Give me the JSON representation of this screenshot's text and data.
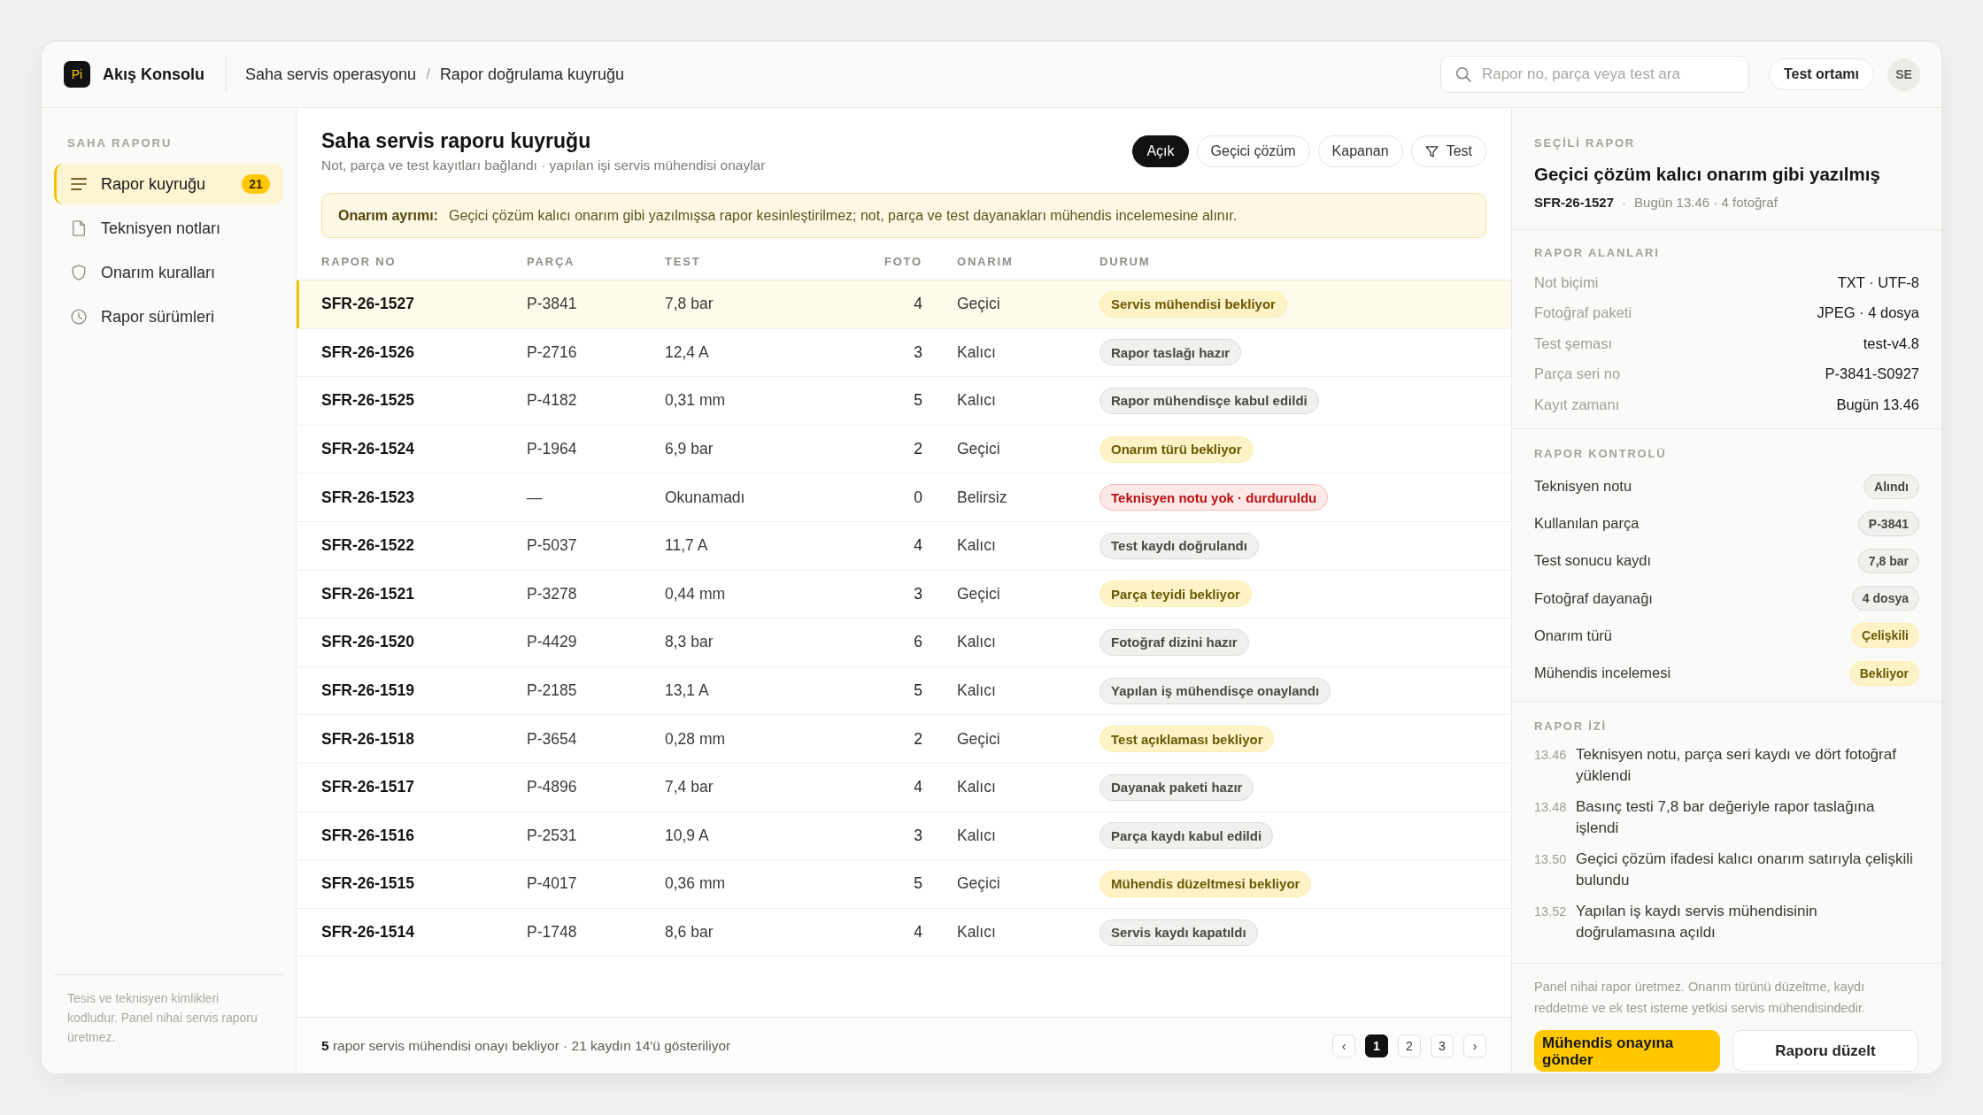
{
  "app": {
    "logo": "Pi",
    "name": "Akış Konsolu"
  },
  "breadcrumb": {
    "items": [
      "Saha servis operasyonu",
      "Rapor doğrulama kuyruğu"
    ],
    "separator": "/"
  },
  "search": {
    "placeholder": "Rapor no, parça veya test ara"
  },
  "environment": "Test ortamı",
  "avatar": "SE",
  "sidebar": {
    "section": "SAHA RAPORU",
    "items": [
      {
        "label": "Rapor kuyruğu",
        "badge": "21",
        "selected": true
      },
      {
        "label": "Teknisyen notları",
        "selected": false
      },
      {
        "label": "Onarım kuralları",
        "selected": false
      },
      {
        "label": "Rapor sürümleri",
        "selected": false
      }
    ],
    "footer": "Tesis ve teknisyen kimlikleri kodludur. Panel nihai servis raporu üretmez."
  },
  "page": {
    "title": "Saha servis raporu kuyruğu",
    "subtitle": "Not, parça ve test kayıtları bağlandı · yapılan işi servis mühendisi onaylar"
  },
  "filters": [
    {
      "label": "Açık",
      "kind": "chip",
      "selected": true
    },
    {
      "label": "Geçici çözüm",
      "kind": "chip",
      "selected": false
    },
    {
      "label": "Kapanan",
      "kind": "chip",
      "selected": false
    },
    {
      "label": "Test",
      "kind": "filter",
      "selected": false
    }
  ],
  "alert": {
    "label": "Onarım ayrımı:",
    "text": "Geçici çözüm kalıcı onarım gibi yazılmışsa rapor kesinleştirilmez; not, parça ve test dayanakları mühendis incelemesine alınır."
  },
  "table": {
    "columns": [
      "RAPOR NO",
      "PARÇA",
      "TEST",
      "FOTO",
      "ONARIM",
      "DURUM"
    ],
    "rows": [
      {
        "report_no": "SFR-26-1527",
        "part": "P-3841",
        "test": "7,8 bar",
        "photos": "4",
        "repair": "Geçici",
        "status": "Servis mühendisi bekliyor",
        "color": "#fdf3c7",
        "selected": true
      },
      {
        "report_no": "SFR-26-1526",
        "part": "P-2716",
        "test": "12,4 A",
        "photos": "3",
        "repair": "Kalıcı",
        "status": "Rapor taslağı hazır",
        "color": "#f0f0ee",
        "selected": false
      },
      {
        "report_no": "SFR-26-1525",
        "part": "P-4182",
        "test": "0,31 mm",
        "photos": "5",
        "repair": "Kalıcı",
        "status": "Rapor mühendisçe kabul edildi",
        "color": "#f0f0ee",
        "selected": false
      },
      {
        "report_no": "SFR-26-1524",
        "part": "P-1964",
        "test": "6,9 bar",
        "photos": "2",
        "repair": "Geçici",
        "status": "Onarım türü bekliyor",
        "color": "#fdf3c7",
        "selected": false
      },
      {
        "report_no": "SFR-26-1523",
        "part": "—",
        "test": "Okunamadı",
        "photos": "0",
        "repair": "Belirsiz",
        "status": "Teknisyen notu yok · durduruldu",
        "color": "#fde8e8",
        "selected": false
      },
      {
        "report_no": "SFR-26-1522",
        "part": "P-5037",
        "test": "11,7 A",
        "photos": "4",
        "repair": "Kalıcı",
        "status": "Test kaydı doğrulandı",
        "color": "#f0f0ee",
        "selected": false
      },
      {
        "report_no": "SFR-26-1521",
        "part": "P-3278",
        "test": "0,44 mm",
        "photos": "3",
        "repair": "Geçici",
        "status": "Parça teyidi bekliyor",
        "color": "#fdf3c7",
        "selected": false
      },
      {
        "report_no": "SFR-26-1520",
        "part": "P-4429",
        "test": "8,3 bar",
        "photos": "6",
        "repair": "Kalıcı",
        "status": "Fotoğraf dizini hazır",
        "color": "#f0f0ee",
        "selected": false
      },
      {
        "report_no": "SFR-26-1519",
        "part": "P-2185",
        "test": "13,1 A",
        "photos": "5",
        "repair": "Kalıcı",
        "status": "Yapılan iş mühendisçe onaylandı",
        "color": "#f0f0ee",
        "selected": false
      },
      {
        "report_no": "SFR-26-1518",
        "part": "P-3654",
        "test": "0,28 mm",
        "photos": "2",
        "repair": "Geçici",
        "status": "Test açıklaması bekliyor",
        "color": "#fdf3c7",
        "selected": false
      },
      {
        "report_no": "SFR-26-1517",
        "part": "P-4896",
        "test": "7,4 bar",
        "photos": "4",
        "repair": "Kalıcı",
        "status": "Dayanak paketi hazır",
        "color": "#f0f0ee",
        "selected": false
      },
      {
        "report_no": "SFR-26-1516",
        "part": "P-2531",
        "test": "10,9 A",
        "photos": "3",
        "repair": "Kalıcı",
        "status": "Parça kaydı kabul edildi",
        "color": "#f0f0ee",
        "selected": false
      },
      {
        "report_no": "SFR-26-1515",
        "part": "P-4017",
        "test": "0,36 mm",
        "photos": "5",
        "repair": "Geçici",
        "status": "Mühendis düzeltmesi bekliyor",
        "color": "#fdf3c7",
        "selected": false
      },
      {
        "report_no": "SFR-26-1514",
        "part": "P-1748",
        "test": "8,6 bar",
        "photos": "4",
        "repair": "Kalıcı",
        "status": "Servis kaydı kapatıldı",
        "color": "#f0f0ee",
        "selected": false
      }
    ],
    "summary": "**5** rapor servis mühendisi onayı bekliyor · 21 kaydın 14'ü gösteriliyor"
  },
  "pagination": {
    "prev": "‹",
    "pages": [
      {
        "label": "1",
        "selected": true
      },
      {
        "label": "2",
        "selected": false
      },
      {
        "label": "3",
        "selected": false
      }
    ],
    "next": "›"
  },
  "detail": {
    "section": "SEÇİLİ RAPOR",
    "title": "Geçici çözüm kalıcı onarım gibi yazılmış",
    "report_no": "SFR-26-1527",
    "separator": "·",
    "meta": "Bugün 13.46 · 4 fotoğraf"
  },
  "fields": {
    "section": "RAPOR ALANLARI",
    "items": [
      {
        "label": "Not biçimi",
        "value": "TXT · UTF-8"
      },
      {
        "label": "Fotoğraf paketi",
        "value": "JPEG · 4 dosya"
      },
      {
        "label": "Test şeması",
        "value": "test-v4.8"
      },
      {
        "label": "Parça seri no",
        "value": "P-3841-S0927"
      },
      {
        "label": "Kayıt zamanı",
        "value": "Bugün 13.46"
      }
    ]
  },
  "checks": {
    "section": "RAPOR KONTROLÜ",
    "items": [
      {
        "label": "Teknisyen notu",
        "value": "Alındı",
        "color": "#f0f0ee"
      },
      {
        "label": "Kullanılan parça",
        "value": "P-3841",
        "color": "#f0f0ee"
      },
      {
        "label": "Test sonucu kaydı",
        "value": "7,8 bar",
        "color": "#f0f0ee"
      },
      {
        "label": "Fotoğraf dayanağı",
        "value": "4 dosya",
        "color": "#f0f0ee"
      },
      {
        "label": "Onarım türü",
        "value": "Çelişkili",
        "color": "#fdf3c7"
      },
      {
        "label": "Mühendis incelemesi",
        "value": "Bekliyor",
        "color": "#fdf3c7"
      }
    ]
  },
  "trail": {
    "section": "RAPOR İZİ",
    "items": [
      {
        "time": "13.46",
        "text": "Teknisyen notu, parça seri kaydı ve dört fotoğraf yüklendi"
      },
      {
        "time": "13.48",
        "text": "Basınç testi 7,8 bar değeriyle rapor taslağına işlendi"
      },
      {
        "time": "13.50",
        "text": "Geçici çözüm ifadesi kalıcı onarım satırıyla çelişkili bulundu"
      },
      {
        "time": "13.52",
        "text": "Yapılan iş kaydı servis mühendisinin doğrulamasına açıldı"
      }
    ]
  },
  "note": "Panel nihai rapor üretmez. Onarım türünü düzeltme, kaydı reddetme ve ek test isteme yetkisi servis mühendisindedir.",
  "actions": [
    {
      "label": "Mühendis onayına gönder",
      "kind": "primary"
    },
    {
      "label": "Raporu düzelt",
      "kind": "secondary"
    }
  ]
}
